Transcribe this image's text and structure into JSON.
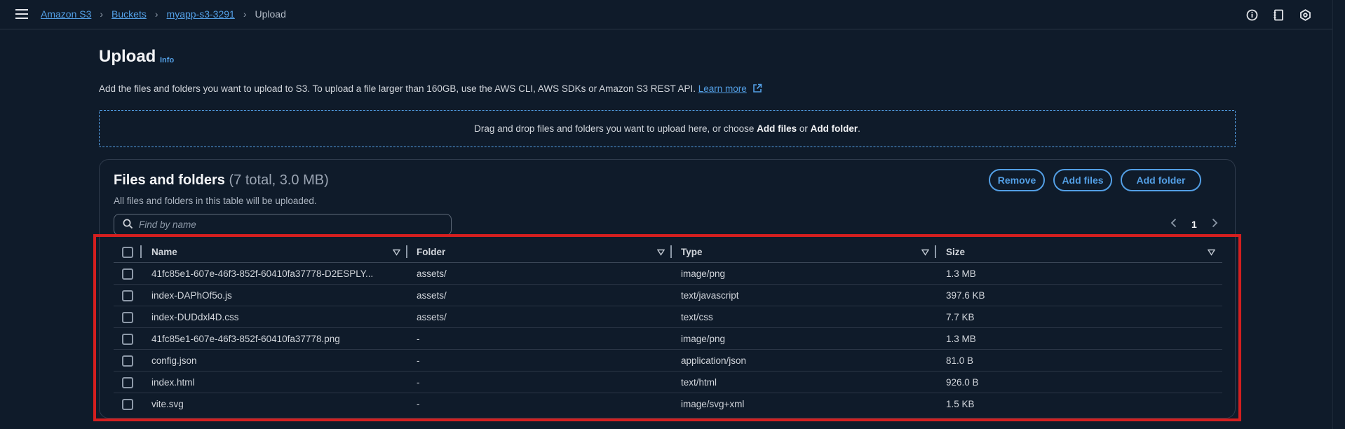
{
  "breadcrumb": {
    "items": [
      "Amazon S3",
      "Buckets",
      "myapp-s3-3291"
    ],
    "current": "Upload"
  },
  "header": {
    "title": "Upload",
    "info": "Info",
    "description": "Add the files and folders you want to upload to S3. To upload a file larger than 160GB, use the AWS CLI, AWS SDKs or Amazon S3 REST API.",
    "learn_more": "Learn more"
  },
  "dropzone": {
    "text_before": "Drag and drop files and folders you want to upload here, or choose ",
    "add_files": "Add files",
    "or": " or ",
    "add_folder": "Add folder",
    "end": "."
  },
  "panel": {
    "title": "Files and folders",
    "count": "(7 total, 3.0 MB)",
    "subtitle": "All files and folders in this table will be uploaded.",
    "buttons": {
      "remove": "Remove",
      "add_files": "Add files",
      "add_folder": "Add folder"
    },
    "search_placeholder": "Find by name",
    "page": "1"
  },
  "table": {
    "columns": [
      "Name",
      "Folder",
      "Type",
      "Size"
    ],
    "rows": [
      {
        "name": "41fc85e1-607e-46f3-852f-60410fa37778-D2ESPLY...",
        "folder": "assets/",
        "type": "image/png",
        "size": "1.3 MB"
      },
      {
        "name": "index-DAPhOf5o.js",
        "folder": "assets/",
        "type": "text/javascript",
        "size": "397.6 KB"
      },
      {
        "name": "index-DUDdxl4D.css",
        "folder": "assets/",
        "type": "text/css",
        "size": "7.7 KB"
      },
      {
        "name": "41fc85e1-607e-46f3-852f-60410fa37778.png",
        "folder": "-",
        "type": "image/png",
        "size": "1.3 MB"
      },
      {
        "name": "config.json",
        "folder": "-",
        "type": "application/json",
        "size": "81.0 B"
      },
      {
        "name": "index.html",
        "folder": "-",
        "type": "text/html",
        "size": "926.0 B"
      },
      {
        "name": "vite.svg",
        "folder": "-",
        "type": "image/svg+xml",
        "size": "1.5 KB"
      }
    ]
  },
  "colors": {
    "accent": "#539fe5",
    "background": "#0f1b2a",
    "highlight": "#d41f1f"
  },
  "icons": [
    "menu-icon",
    "chevron-right-icon",
    "info-circle-icon",
    "notebook-icon",
    "settings-hex-icon",
    "external-link-icon",
    "search-icon",
    "chevron-left-icon",
    "sort-down-icon"
  ]
}
